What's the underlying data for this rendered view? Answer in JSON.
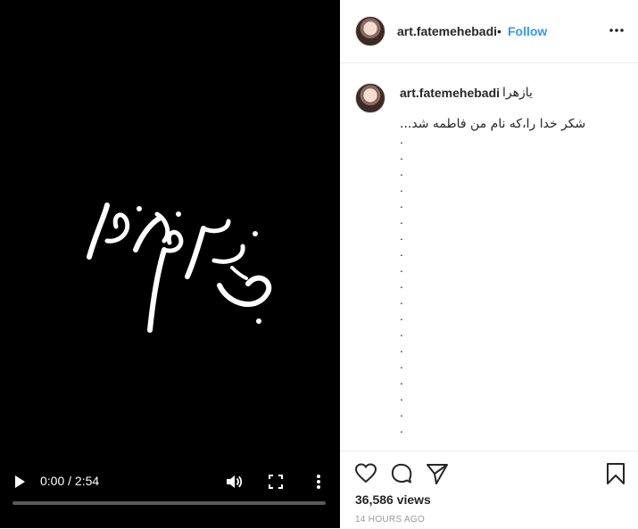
{
  "video": {
    "current_time": "0:00",
    "separator": " / ",
    "duration": "2:54",
    "progress_fraction": 0.0,
    "overlay_text": "به نام خدا"
  },
  "header": {
    "username": "art.fatemehebadi",
    "dot": "•",
    "follow_label": "Follow"
  },
  "caption": {
    "username": "art.fatemehebadi",
    "first_text": "یازهرا",
    "line": "...شکر خدا را،که نام من فاطمه شد",
    "dot_lines": [
      ".",
      ".",
      ".",
      ".",
      ".",
      ".",
      ".",
      ".",
      ".",
      ".",
      ".",
      ".",
      ".",
      ".",
      ".",
      ".",
      ".",
      ".",
      "."
    ]
  },
  "footer": {
    "views": "36,586 views",
    "timestamp": "14 HOURS AGO"
  },
  "colors": {
    "accent": "#3897f0",
    "video_bg": "#000000",
    "muted_text": "#999999"
  }
}
